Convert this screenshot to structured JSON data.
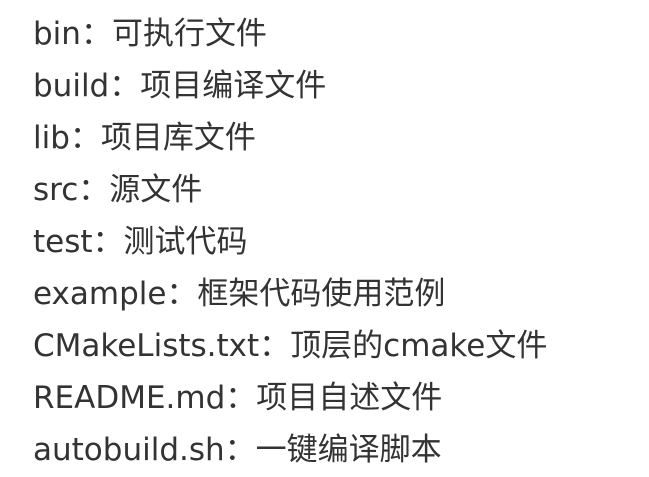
{
  "lines": [
    "bin：可执行文件",
    "build：项目编译文件",
    "lib：项目库文件",
    "src：源文件",
    "test：测试代码",
    "example：框架代码使用范例",
    "CMakeLists.txt：顶层的cmake文件",
    "README.md：项目自述文件",
    "autobuild.sh：一键编译脚本"
  ]
}
